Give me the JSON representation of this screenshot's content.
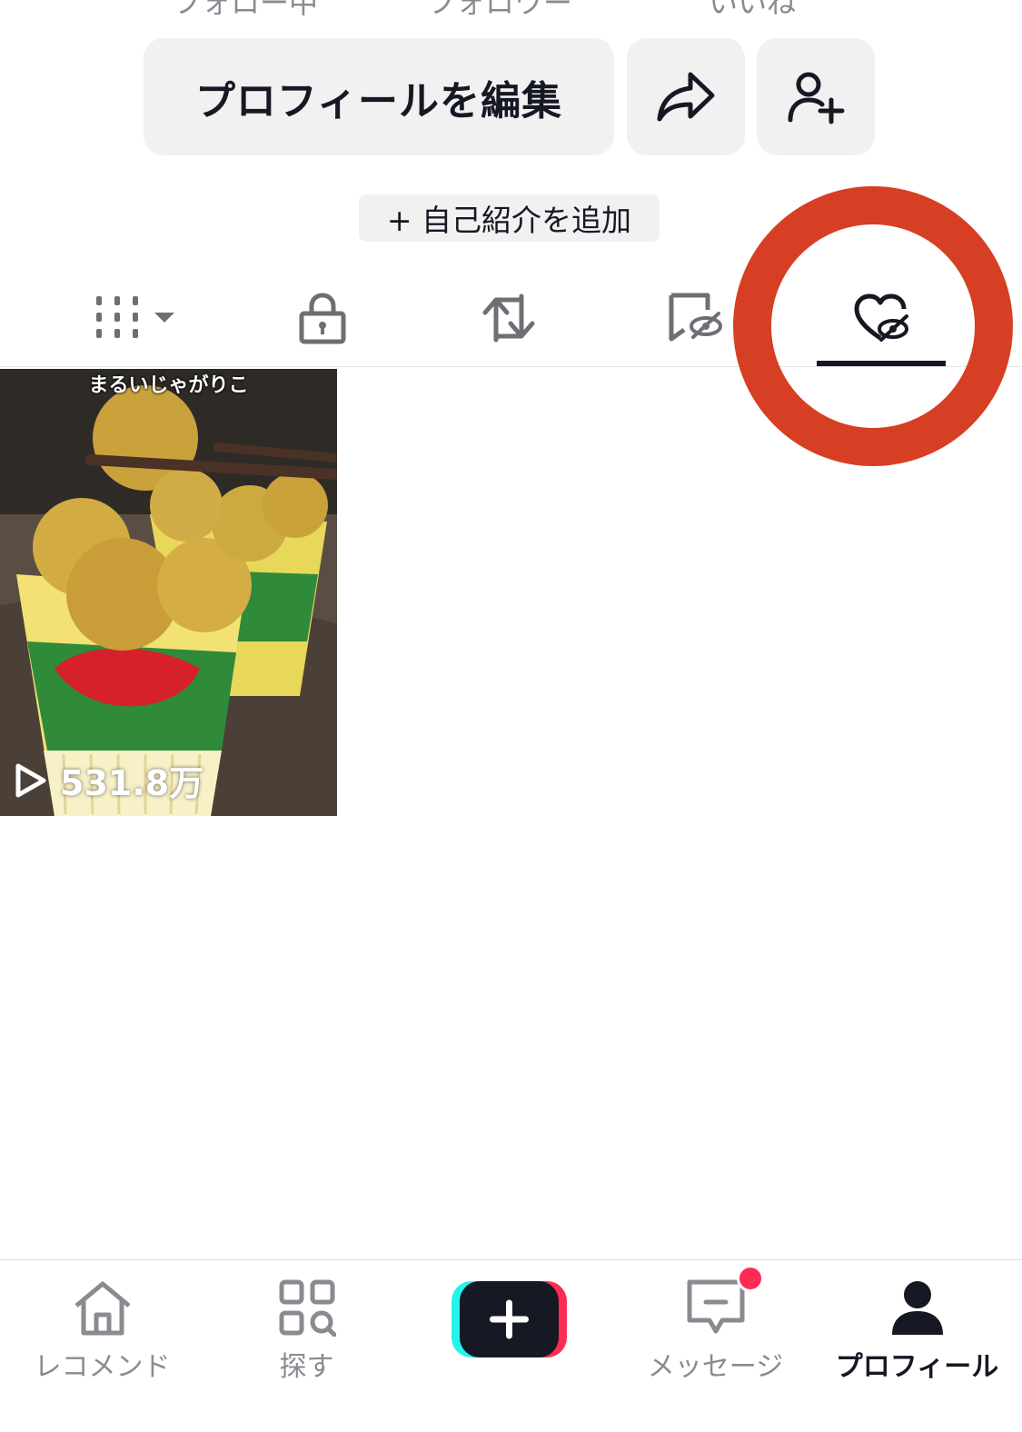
{
  "stats": {
    "labels": [
      "フォロー中",
      "フォロワー",
      "いいね"
    ]
  },
  "actions": {
    "edit_profile": "プロフィールを編集",
    "add_bio": "+ 自己紹介を追加"
  },
  "tabs": [
    {
      "name": "videos",
      "icon": "grid-icon"
    },
    {
      "name": "private",
      "icon": "lock-icon"
    },
    {
      "name": "reposts",
      "icon": "repost-icon"
    },
    {
      "name": "favorites",
      "icon": "bookmark-hidden-icon"
    },
    {
      "name": "liked",
      "icon": "heart-hidden-icon",
      "selected": true
    }
  ],
  "videos": [
    {
      "title": "まるいじゃがりこ",
      "views": "531.8万"
    }
  ],
  "bottom_nav": {
    "home": "レコメンド",
    "discover": "探す",
    "inbox": "メッセージ",
    "profile": "プロフィール"
  },
  "colors": {
    "highlight_ring": "#d63f24",
    "notification": "#fe2c55",
    "button_bg": "#f1f1f2"
  }
}
